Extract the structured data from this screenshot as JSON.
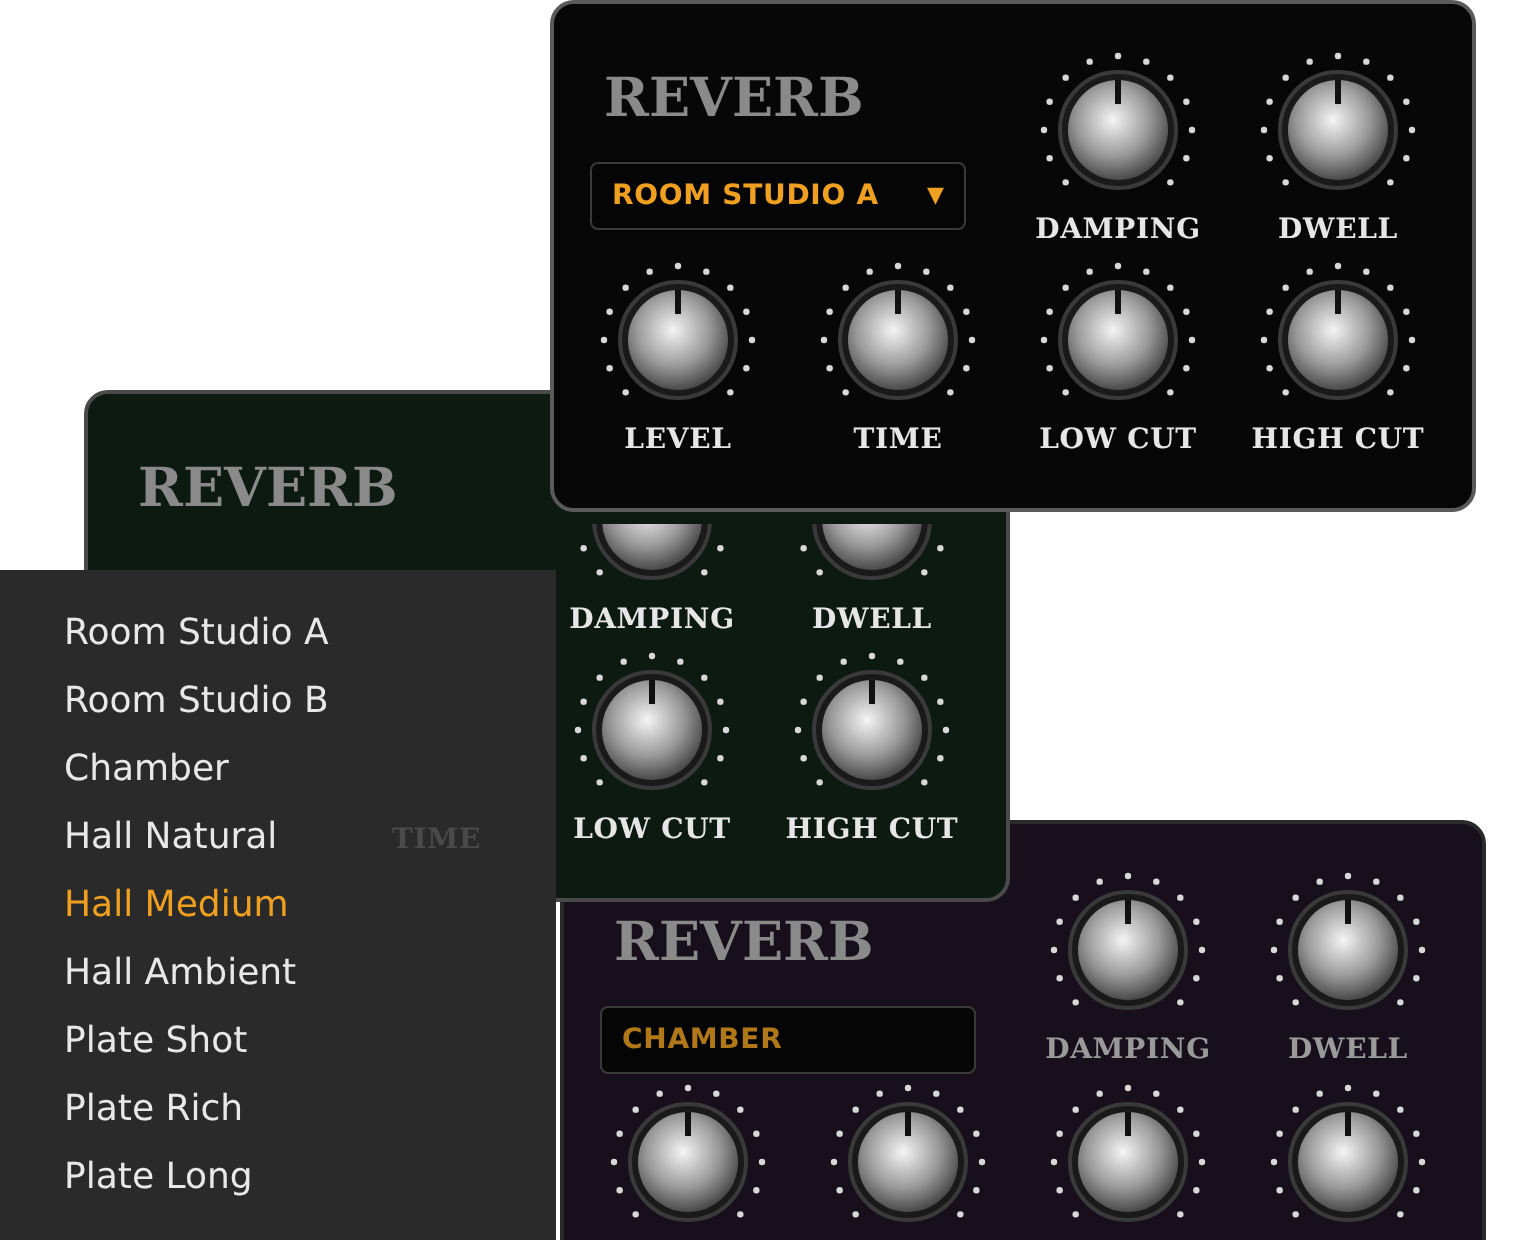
{
  "panels": [
    {
      "title": "REVERB",
      "dropdown": {
        "value": "ROOM STUDIO A",
        "arrow": "▼"
      },
      "knobs": [
        {
          "label": "DAMPING"
        },
        {
          "label": "DWELL"
        },
        {
          "label": "LEVEL"
        },
        {
          "label": "TIME"
        },
        {
          "label": "LOW CUT"
        },
        {
          "label": "HIGH CUT"
        }
      ]
    },
    {
      "title": "REVERB",
      "knobs": [
        {
          "label": "DAMPING"
        },
        {
          "label": "DWELL"
        },
        {
          "label": "LOW CUT"
        },
        {
          "label": "HIGH CUT"
        }
      ],
      "covered_label": "TIME"
    },
    {
      "title": "REVERB",
      "dropdown": {
        "value": "CHAMBER"
      },
      "knobs": [
        {
          "label": "DAMPING"
        },
        {
          "label": "DWELL"
        }
      ]
    }
  ],
  "menu": {
    "items": [
      {
        "label": "Room Studio A",
        "selected": false
      },
      {
        "label": "Room Studio B",
        "selected": false
      },
      {
        "label": "Chamber",
        "selected": false
      },
      {
        "label": "Hall Natural",
        "selected": false
      },
      {
        "label": "Hall Medium",
        "selected": true
      },
      {
        "label": "Hall Ambient",
        "selected": false
      },
      {
        "label": "Plate Shot",
        "selected": false
      },
      {
        "label": "Plate Rich",
        "selected": false
      },
      {
        "label": "Plate Long",
        "selected": false
      }
    ]
  }
}
